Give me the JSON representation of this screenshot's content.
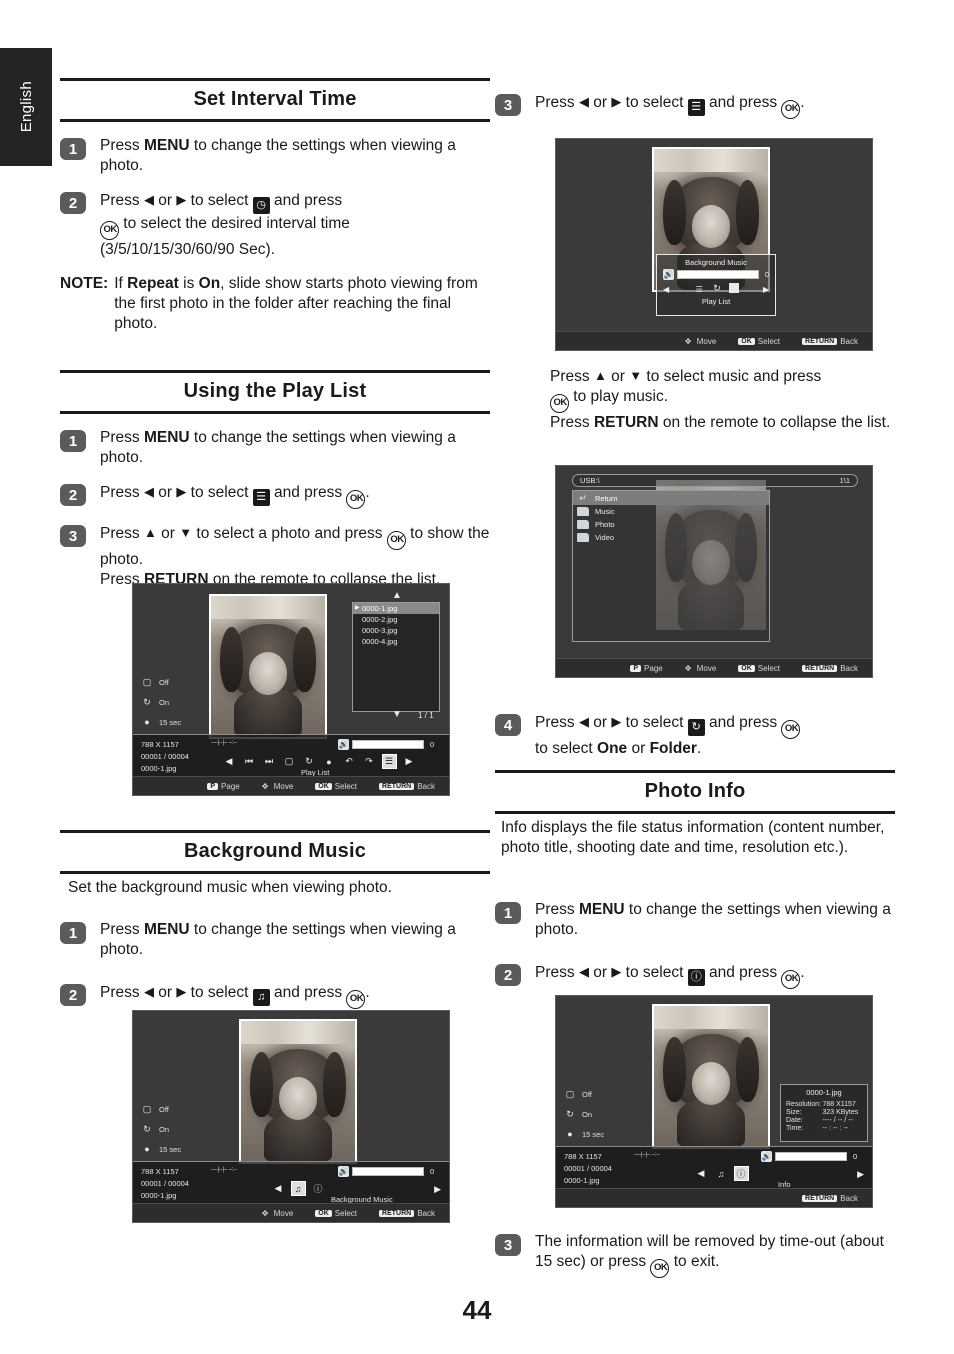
{
  "page": {
    "language_tab": "English",
    "page_number": "44"
  },
  "sections": {
    "set_interval_time": {
      "title": "Set Interval Time",
      "steps": [
        {
          "num": "1",
          "text_a": "Press ",
          "bold_a": "MENU",
          "text_b": " to change the settings when viewing a photo."
        },
        {
          "num": "2",
          "line1_a": "Press ",
          "line1_b": " or ",
          "line1_c": " to select ",
          "line1_d": " and press ",
          "line2": " to select the desired interval time",
          "line3": "(3/5/10/15/30/60/90 Sec)."
        }
      ],
      "note": {
        "label": "NOTE:",
        "text_a": "If ",
        "bold_a": "Repeat",
        "text_b": " is ",
        "bold_b": "On",
        "text_c": ", slide show starts photo viewing from the first photo in the folder after reaching the final photo."
      }
    },
    "using_the_play_list": {
      "title": "Using the Play List",
      "steps": [
        {
          "num": "1",
          "text_a": "Press ",
          "bold_a": "MENU",
          "text_b": " to change the settings when viewing a photo."
        },
        {
          "num": "2",
          "text_a": "Press ",
          "text_b": " or ",
          "text_c": " to select ",
          "text_d": " and press "
        },
        {
          "num": "3",
          "line1_a": "Press ",
          "line1_b": " or ",
          "line1_c": " to select a photo and press ",
          "line1_d": " to show the photo.",
          "line2_a": "Press ",
          "line2_bold": "RETURN",
          "line2_b": " on the remote to collapse the list."
        }
      ]
    },
    "background_music": {
      "title": "Background Music",
      "intro": "Set the background music when viewing photo.",
      "steps": [
        {
          "num": "1",
          "text_a": "Press ",
          "bold_a": "MENU",
          "text_b": " to change the settings when viewing a photo."
        },
        {
          "num": "2",
          "text_a": "Press ",
          "text_b": " or ",
          "text_c": " to select ",
          "text_d": " and press "
        }
      ]
    },
    "play_list_right": {
      "step3": {
        "num": "3",
        "text_a": "Press ",
        "text_b": " or ",
        "text_c": " to select ",
        "text_d": " and press "
      },
      "after_text": {
        "line1_a": "Press ",
        "line1_b": " or ",
        "line1_c": " to select music and press",
        "line2": " to play music.",
        "line3_a": "Press ",
        "line3_bold": "RETURN",
        "line3_b": " on the remote to collapse the list."
      },
      "step4": {
        "num": "4",
        "text_a": "Press ",
        "text_b": " or ",
        "text_c": " to select ",
        "text_d": " and press ",
        "line2_a": "to select ",
        "line2_bold_a": "One",
        "line2_b": " or ",
        "line2_bold_b": "Folder",
        "line2_c": "."
      }
    },
    "photo_info": {
      "title": "Photo Info",
      "intro": "Info displays the file status information (content number, photo title, shooting date and time, resolution etc.).",
      "steps": [
        {
          "num": "1",
          "text_a": "Press ",
          "bold_a": "MENU",
          "text_b": " to change the settings when viewing a photo."
        },
        {
          "num": "2",
          "text_a": "Press ",
          "text_b": " or ",
          "text_c": " to select ",
          "text_d": " and press "
        },
        {
          "num": "3",
          "text_a": "The information will be removed by time-out (about 15 sec) or press ",
          "text_b": " to exit."
        }
      ]
    }
  },
  "screenshots": {
    "playlist": {
      "status": [
        {
          "icon": "slideshow-icon",
          "label": "Off"
        },
        {
          "icon": "repeat-icon",
          "label": "On"
        },
        {
          "icon": "clock-icon",
          "label": "15 sec"
        }
      ],
      "info_lines": [
        "788 X 1157",
        "00001 / 00004",
        "0000-1.jpg"
      ],
      "volume_value": "0",
      "control_label": "Play List",
      "playlist_items": [
        "0000-1.jpg",
        "0000-2.jpg",
        "0000-3.jpg",
        "0000-4.jpg"
      ],
      "playlist_selected_index": 0,
      "page_counter": "1 / 1",
      "hints": [
        {
          "key": "P",
          "label": "Page"
        },
        {
          "key": "",
          "label": "Move"
        },
        {
          "key": "OK",
          "label": "Select"
        },
        {
          "key": "RETURN",
          "label": "Back"
        }
      ]
    },
    "background_music": {
      "status": [
        {
          "icon": "slideshow-icon",
          "label": "Off"
        },
        {
          "icon": "repeat-icon",
          "label": "On"
        },
        {
          "icon": "clock-icon",
          "label": "15 sec"
        }
      ],
      "info_lines": [
        "788 X 1157",
        "00001 / 00004",
        "0000-1.jpg"
      ],
      "volume_value": "0",
      "control_label": "Background Music",
      "hints": [
        {
          "key": "",
          "label": "Move"
        },
        {
          "key": "OK",
          "label": "Select"
        },
        {
          "key": "RETURN",
          "label": "Back"
        }
      ]
    },
    "bgm_popup": {
      "title": "Background Music",
      "volume_value": "0",
      "footer_label": "Play List",
      "hints": [
        {
          "key": "",
          "label": "Move"
        },
        {
          "key": "OK",
          "label": "Select"
        },
        {
          "key": "RETURN",
          "label": "Back"
        }
      ]
    },
    "usb_browser": {
      "path": "USB:\\",
      "page_counter": "1\\1",
      "rows": [
        {
          "icon": "return-icon",
          "label": "Return",
          "selected": true
        },
        {
          "icon": "folder-icon",
          "label": "Music",
          "selected": false
        },
        {
          "icon": "folder-icon",
          "label": "Photo",
          "selected": false
        },
        {
          "icon": "folder-icon",
          "label": "Video",
          "selected": false
        }
      ],
      "hints": [
        {
          "key": "P",
          "label": "Page"
        },
        {
          "key": "",
          "label": "Move"
        },
        {
          "key": "OK",
          "label": "Select"
        },
        {
          "key": "RETURN",
          "label": "Back"
        }
      ]
    },
    "photo_info": {
      "status": [
        {
          "icon": "slideshow-icon",
          "label": "Off"
        },
        {
          "icon": "repeat-icon",
          "label": "On"
        },
        {
          "icon": "clock-icon",
          "label": "15 sec"
        }
      ],
      "info_lines": [
        "788 X 1157",
        "00001 / 00004",
        "0000-1.jpg"
      ],
      "volume_value": "0",
      "control_label": "Info",
      "panel": {
        "title": "0000-1.jpg",
        "rows": [
          {
            "key": "Resolution:",
            "value": "788 X1157"
          },
          {
            "key": "Size:",
            "value": "323 KBytes"
          },
          {
            "key": "Date:",
            "value": "---- / -- / --"
          },
          {
            "key": "Time:",
            "value": "-- : -- : --"
          }
        ]
      },
      "hints": [
        {
          "key": "RETURN",
          "label": "Back"
        }
      ]
    }
  },
  "colors": {
    "ink": "#1a1a1a",
    "step_badge": "#5b5b5b",
    "tab_bg": "#242424",
    "tv_bg": "#3a3a3a"
  }
}
